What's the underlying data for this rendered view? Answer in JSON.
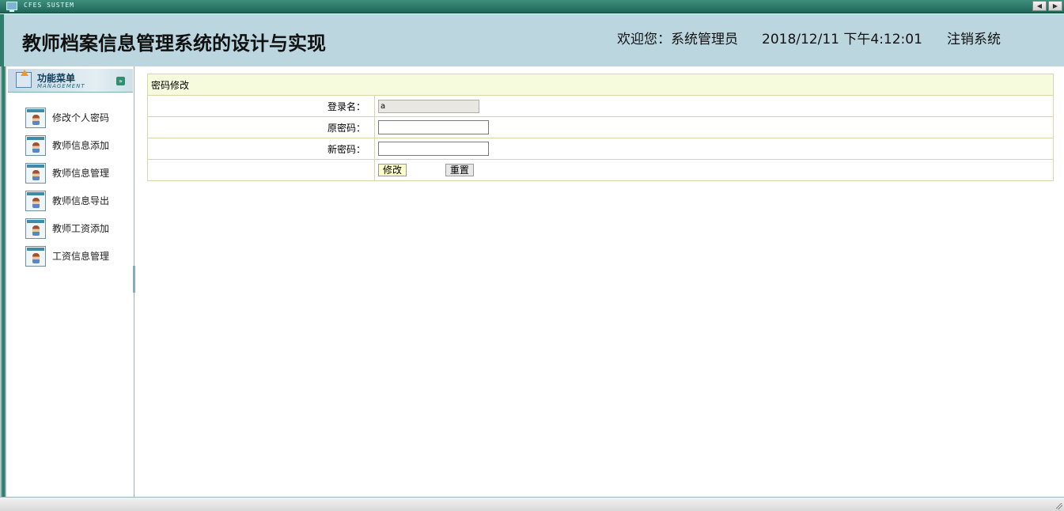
{
  "window": {
    "system_title": "CFES SUSTEM",
    "nav_prev_icon": "arrow-left-icon",
    "nav_next_icon": "arrow-right-icon"
  },
  "header": {
    "title": "教师档案信息管理系统的设计与实现",
    "welcome": "欢迎您：系统管理员",
    "datetime": "2018/12/11 下午4:12:01",
    "logout": "注销系统"
  },
  "sidebar": {
    "menu_title": "功能菜单",
    "menu_subtitle": "MANAGEMENT",
    "items": [
      {
        "label": "修改个人密码",
        "icon": "teacher-icon"
      },
      {
        "label": "教师信息添加",
        "icon": "teacher-icon"
      },
      {
        "label": "教师信息管理",
        "icon": "teacher-icon"
      },
      {
        "label": "教师信息导出",
        "icon": "teacher-icon"
      },
      {
        "label": "教师工资添加",
        "icon": "teacher-icon"
      },
      {
        "label": "工资信息管理",
        "icon": "teacher-icon"
      }
    ]
  },
  "form": {
    "caption": "密码修改",
    "login_label": "登录名：",
    "login_value": "a",
    "old_password_label": "原密码：",
    "old_password_value": "",
    "new_password_label": "新密码：",
    "new_password_value": "",
    "submit_label": "修改",
    "reset_label": "重置"
  },
  "colors": {
    "header_bg": "#bcd6e0",
    "frame_green": "#2f7d6d",
    "caption_bg": "#f7fbde",
    "table_border": "#d7d7a9"
  }
}
